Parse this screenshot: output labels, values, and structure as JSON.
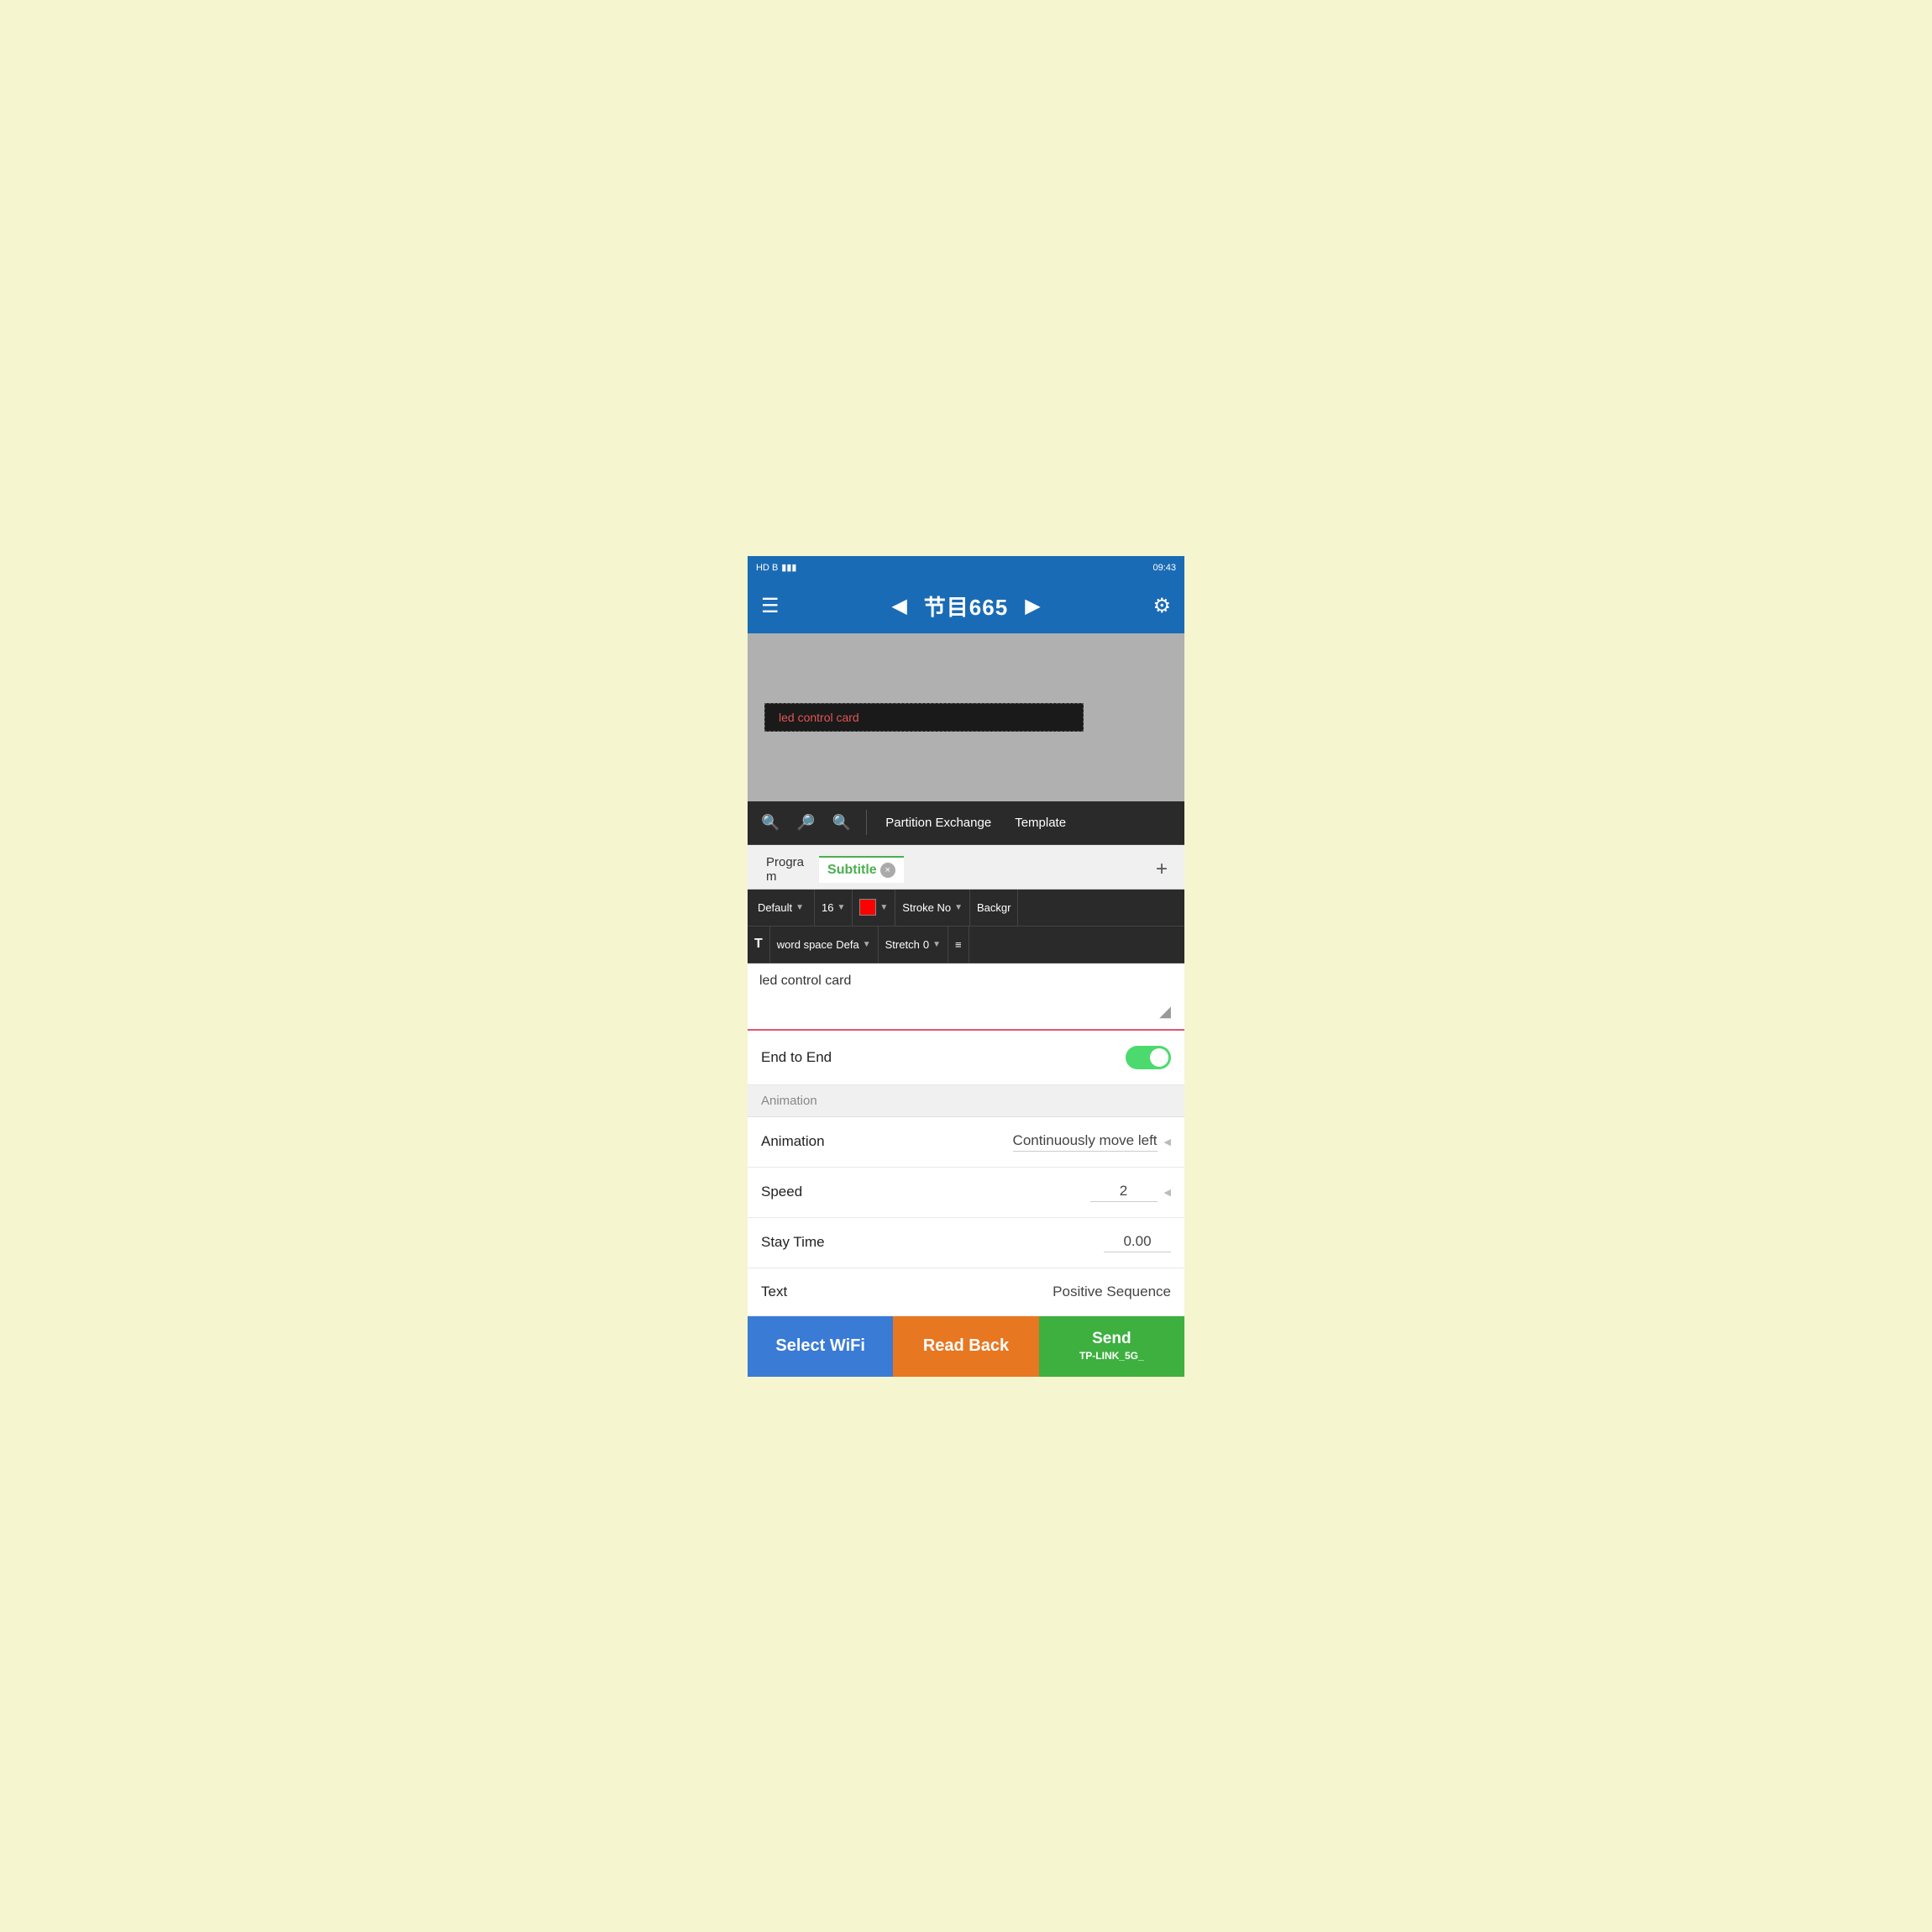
{
  "statusBar": {
    "left": "HD B",
    "right": "09:43"
  },
  "topNav": {
    "menuIcon": "☰",
    "prevIcon": "◀",
    "title": "节目665",
    "nextIcon": "▶",
    "settingsIcon": "⚙"
  },
  "preview": {
    "text": "led control card"
  },
  "toolbar": {
    "searchIcon": "🔍",
    "zoomInIcon": "🔍+",
    "zoomOutIcon": "🔍-",
    "partitionExchange": "Partition Exchange",
    "template": "Template"
  },
  "tabs": {
    "programLabel": "Progra\nm",
    "subtitleLabel": "Subtitle",
    "addIcon": "+"
  },
  "formatRow1": {
    "font": "Default",
    "fontSize": "16",
    "colorLabel": "red",
    "stroke": "Stroke No",
    "background": "Backgr"
  },
  "formatRow2": {
    "boldLabel": "T",
    "wordSpace": "word space",
    "wordSpaceVal": "Defa",
    "stretch": "Stretch",
    "stretchVal": "0",
    "alignIcon": "≡"
  },
  "textEdit": {
    "content": "led control card"
  },
  "settings": {
    "endToEnd": {
      "label": "End to End",
      "value": "on"
    },
    "animationSection": "Animation",
    "animation": {
      "label": "Animation",
      "value": "Continuously move left"
    },
    "speed": {
      "label": "Speed",
      "value": "2"
    },
    "stayTime": {
      "label": "Stay Time",
      "value": "0.00"
    },
    "text": {
      "label": "Text",
      "value": "Positive Sequence"
    }
  },
  "bottomButtons": {
    "selectWifi": "Select WiFi",
    "readBack": "Read Back",
    "send": "Send",
    "sendSub": "TP-LINK_5G_"
  }
}
